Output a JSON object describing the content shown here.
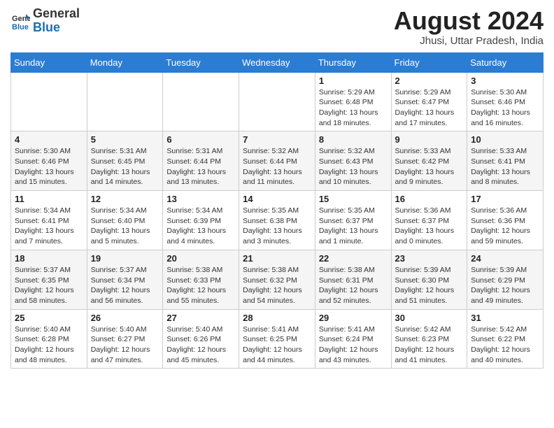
{
  "header": {
    "logo_general": "General",
    "logo_blue": "Blue",
    "month_year": "August 2024",
    "location": "Jhusi, Uttar Pradesh, India"
  },
  "weekdays": [
    "Sunday",
    "Monday",
    "Tuesday",
    "Wednesday",
    "Thursday",
    "Friday",
    "Saturday"
  ],
  "weeks": [
    [
      {
        "day": "",
        "info": ""
      },
      {
        "day": "",
        "info": ""
      },
      {
        "day": "",
        "info": ""
      },
      {
        "day": "",
        "info": ""
      },
      {
        "day": "1",
        "info": "Sunrise: 5:29 AM\nSunset: 6:48 PM\nDaylight: 13 hours\nand 18 minutes."
      },
      {
        "day": "2",
        "info": "Sunrise: 5:29 AM\nSunset: 6:47 PM\nDaylight: 13 hours\nand 17 minutes."
      },
      {
        "day": "3",
        "info": "Sunrise: 5:30 AM\nSunset: 6:46 PM\nDaylight: 13 hours\nand 16 minutes."
      }
    ],
    [
      {
        "day": "4",
        "info": "Sunrise: 5:30 AM\nSunset: 6:46 PM\nDaylight: 13 hours\nand 15 minutes."
      },
      {
        "day": "5",
        "info": "Sunrise: 5:31 AM\nSunset: 6:45 PM\nDaylight: 13 hours\nand 14 minutes."
      },
      {
        "day": "6",
        "info": "Sunrise: 5:31 AM\nSunset: 6:44 PM\nDaylight: 13 hours\nand 13 minutes."
      },
      {
        "day": "7",
        "info": "Sunrise: 5:32 AM\nSunset: 6:44 PM\nDaylight: 13 hours\nand 11 minutes."
      },
      {
        "day": "8",
        "info": "Sunrise: 5:32 AM\nSunset: 6:43 PM\nDaylight: 13 hours\nand 10 minutes."
      },
      {
        "day": "9",
        "info": "Sunrise: 5:33 AM\nSunset: 6:42 PM\nDaylight: 13 hours\nand 9 minutes."
      },
      {
        "day": "10",
        "info": "Sunrise: 5:33 AM\nSunset: 6:41 PM\nDaylight: 13 hours\nand 8 minutes."
      }
    ],
    [
      {
        "day": "11",
        "info": "Sunrise: 5:34 AM\nSunset: 6:41 PM\nDaylight: 13 hours\nand 7 minutes."
      },
      {
        "day": "12",
        "info": "Sunrise: 5:34 AM\nSunset: 6:40 PM\nDaylight: 13 hours\nand 5 minutes."
      },
      {
        "day": "13",
        "info": "Sunrise: 5:34 AM\nSunset: 6:39 PM\nDaylight: 13 hours\nand 4 minutes."
      },
      {
        "day": "14",
        "info": "Sunrise: 5:35 AM\nSunset: 6:38 PM\nDaylight: 13 hours\nand 3 minutes."
      },
      {
        "day": "15",
        "info": "Sunrise: 5:35 AM\nSunset: 6:37 PM\nDaylight: 13 hours\nand 1 minute."
      },
      {
        "day": "16",
        "info": "Sunrise: 5:36 AM\nSunset: 6:37 PM\nDaylight: 13 hours\nand 0 minutes."
      },
      {
        "day": "17",
        "info": "Sunrise: 5:36 AM\nSunset: 6:36 PM\nDaylight: 12 hours\nand 59 minutes."
      }
    ],
    [
      {
        "day": "18",
        "info": "Sunrise: 5:37 AM\nSunset: 6:35 PM\nDaylight: 12 hours\nand 58 minutes."
      },
      {
        "day": "19",
        "info": "Sunrise: 5:37 AM\nSunset: 6:34 PM\nDaylight: 12 hours\nand 56 minutes."
      },
      {
        "day": "20",
        "info": "Sunrise: 5:38 AM\nSunset: 6:33 PM\nDaylight: 12 hours\nand 55 minutes."
      },
      {
        "day": "21",
        "info": "Sunrise: 5:38 AM\nSunset: 6:32 PM\nDaylight: 12 hours\nand 54 minutes."
      },
      {
        "day": "22",
        "info": "Sunrise: 5:38 AM\nSunset: 6:31 PM\nDaylight: 12 hours\nand 52 minutes."
      },
      {
        "day": "23",
        "info": "Sunrise: 5:39 AM\nSunset: 6:30 PM\nDaylight: 12 hours\nand 51 minutes."
      },
      {
        "day": "24",
        "info": "Sunrise: 5:39 AM\nSunset: 6:29 PM\nDaylight: 12 hours\nand 49 minutes."
      }
    ],
    [
      {
        "day": "25",
        "info": "Sunrise: 5:40 AM\nSunset: 6:28 PM\nDaylight: 12 hours\nand 48 minutes."
      },
      {
        "day": "26",
        "info": "Sunrise: 5:40 AM\nSunset: 6:27 PM\nDaylight: 12 hours\nand 47 minutes."
      },
      {
        "day": "27",
        "info": "Sunrise: 5:40 AM\nSunset: 6:26 PM\nDaylight: 12 hours\nand 45 minutes."
      },
      {
        "day": "28",
        "info": "Sunrise: 5:41 AM\nSunset: 6:25 PM\nDaylight: 12 hours\nand 44 minutes."
      },
      {
        "day": "29",
        "info": "Sunrise: 5:41 AM\nSunset: 6:24 PM\nDaylight: 12 hours\nand 43 minutes."
      },
      {
        "day": "30",
        "info": "Sunrise: 5:42 AM\nSunset: 6:23 PM\nDaylight: 12 hours\nand 41 minutes."
      },
      {
        "day": "31",
        "info": "Sunrise: 5:42 AM\nSunset: 6:22 PM\nDaylight: 12 hours\nand 40 minutes."
      }
    ]
  ]
}
